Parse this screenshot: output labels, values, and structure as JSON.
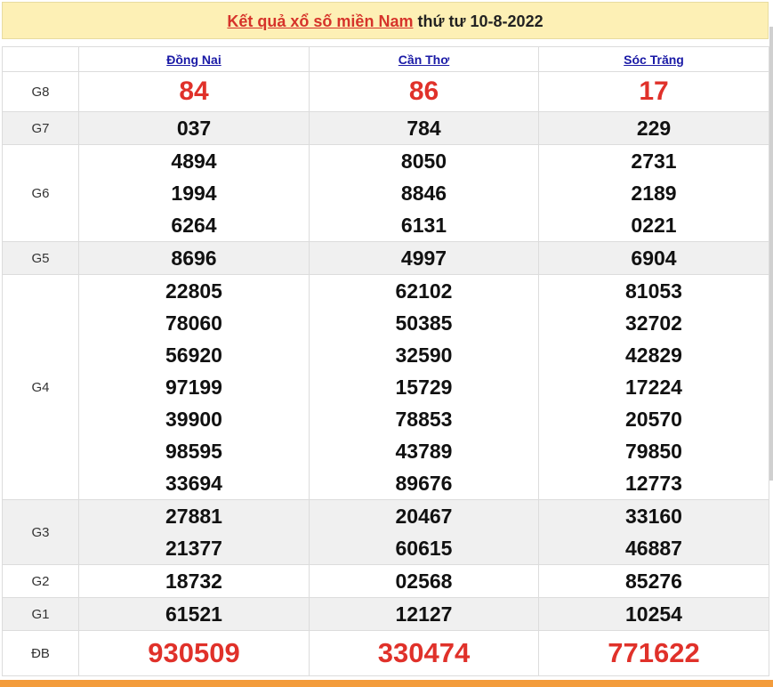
{
  "title": {
    "link_text": "Kết quả xổ số miền Nam",
    "suffix": " thứ tư 10-8-2022"
  },
  "provinces": [
    "Đồng Nai",
    "Cần Thơ",
    "Sóc Trăng"
  ],
  "rows": [
    {
      "label": "G8",
      "values": [
        [
          "84"
        ],
        [
          "86"
        ],
        [
          "17"
        ]
      ]
    },
    {
      "label": "G7",
      "values": [
        [
          "037"
        ],
        [
          "784"
        ],
        [
          "229"
        ]
      ]
    },
    {
      "label": "G6",
      "values": [
        [
          "4894",
          "1994",
          "6264"
        ],
        [
          "8050",
          "8846",
          "6131"
        ],
        [
          "2731",
          "2189",
          "0221"
        ]
      ]
    },
    {
      "label": "G5",
      "values": [
        [
          "8696"
        ],
        [
          "4997"
        ],
        [
          "6904"
        ]
      ]
    },
    {
      "label": "G4",
      "values": [
        [
          "22805",
          "78060",
          "56920",
          "97199",
          "39900",
          "98595",
          "33694"
        ],
        [
          "62102",
          "50385",
          "32590",
          "15729",
          "78853",
          "43789",
          "89676"
        ],
        [
          "81053",
          "32702",
          "42829",
          "17224",
          "20570",
          "79850",
          "12773"
        ]
      ]
    },
    {
      "label": "G3",
      "values": [
        [
          "27881",
          "21377"
        ],
        [
          "20467",
          "60615"
        ],
        [
          "33160",
          "46887"
        ]
      ]
    },
    {
      "label": "G2",
      "values": [
        [
          "18732"
        ],
        [
          "02568"
        ],
        [
          "85276"
        ]
      ]
    },
    {
      "label": "G1",
      "values": [
        [
          "61521"
        ],
        [
          "12127"
        ],
        [
          "10254"
        ]
      ]
    },
    {
      "label": "ĐB",
      "values": [
        [
          "930509"
        ],
        [
          "330474"
        ],
        [
          "771622"
        ]
      ]
    }
  ],
  "colors": {
    "accent_red": "#e0312a",
    "header_bg": "#fdf0b5",
    "link_blue": "#1a1aa6",
    "bottom_bar": "#f39c3c"
  }
}
